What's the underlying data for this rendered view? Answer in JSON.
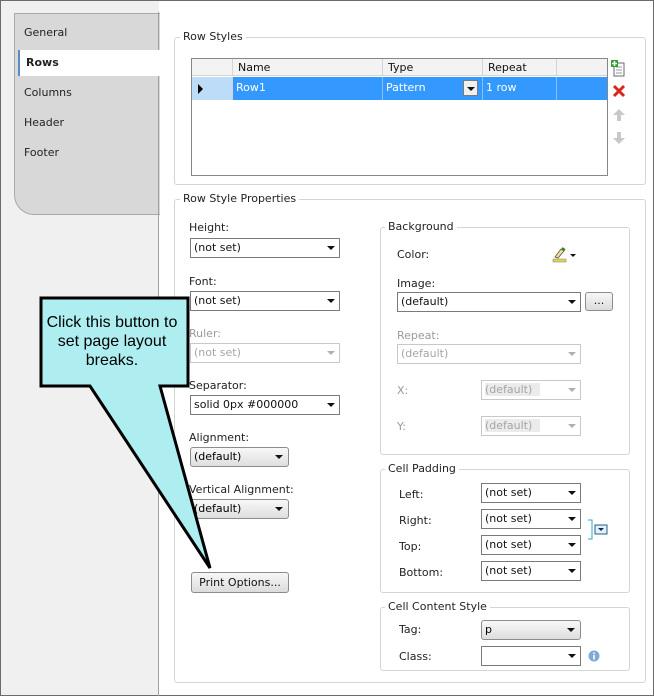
{
  "tabs": [
    {
      "label": "General"
    },
    {
      "label": "Rows"
    },
    {
      "label": "Columns"
    },
    {
      "label": "Header"
    },
    {
      "label": "Footer"
    }
  ],
  "row_styles": {
    "legend": "Row Styles",
    "columns": [
      "Name",
      "Type",
      "Repeat"
    ],
    "rows": [
      {
        "name": "Row1",
        "type": "Pattern",
        "repeat": "1 row"
      }
    ]
  },
  "props": {
    "legend": "Row Style Properties",
    "height_label": "Height:",
    "height_value": "(not set)",
    "font_label": "Font:",
    "font_value": "(not set)",
    "ruler_label": "Ruler:",
    "ruler_value": "(not set)",
    "separator_label": "Separator:",
    "separator_value": "solid 0px #000000",
    "alignment_label": "Alignment:",
    "alignment_value": "(default)",
    "valign_label": "Vertical Alignment:",
    "valign_value": "(default)",
    "print_button": "Print Options..."
  },
  "background": {
    "legend": "Background",
    "color_label": "Color:",
    "image_label": "Image:",
    "image_value": "(default)",
    "browse_button": "...",
    "repeat_label": "Repeat:",
    "repeat_value": "(default)",
    "x_label": "X:",
    "x_value": "(default)",
    "y_label": "Y:",
    "y_value": "(default)"
  },
  "padding": {
    "legend": "Cell Padding",
    "left_label": "Left:",
    "left_value": "(not set)",
    "right_label": "Right:",
    "right_value": "(not set)",
    "top_label": "Top:",
    "top_value": "(not set)",
    "bottom_label": "Bottom:",
    "bottom_value": "(not set)"
  },
  "content_style": {
    "legend": "Cell Content Style",
    "tag_label": "Tag:",
    "tag_value": "p",
    "class_label": "Class:",
    "class_value": ""
  },
  "callout": {
    "text": "Click this button to set page layout breaks."
  },
  "colors": {
    "selection": "#3399ff",
    "callout_fill": "#aeeef0",
    "callout_border": "#000000"
  }
}
